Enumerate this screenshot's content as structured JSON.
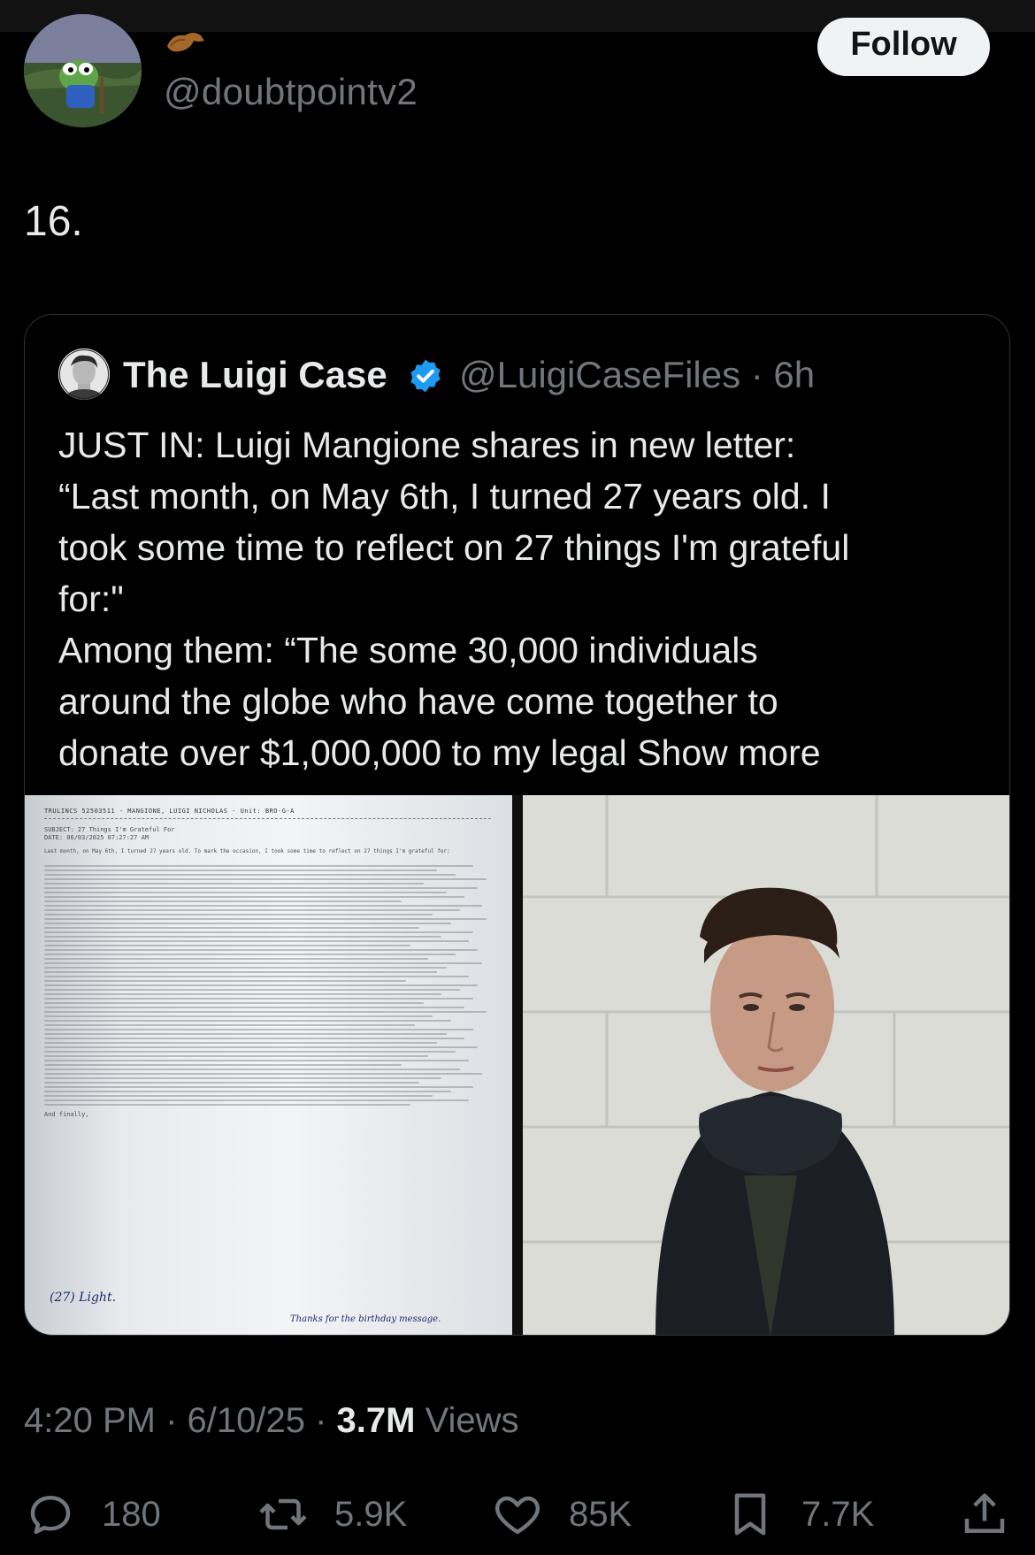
{
  "header": {
    "handle": "@doubtpointv2",
    "follow_label": "Follow",
    "avatar_icon": "frog-avatar-icon",
    "badge_icon": "flexed-arm-emoji-icon"
  },
  "post": {
    "text": "16."
  },
  "quote": {
    "name": "The Luigi Case",
    "handle_time": "@LuigiCaseFiles · 6h",
    "verified_color": "#1d9bf0",
    "lines": [
      "JUST IN: Luigi Mangione shares in new letter:",
      "“Last month, on May 6th, I turned 27 years old. I",
      "took some time to reflect on 27 things I'm grateful",
      "for:\"",
      "Among them: “The some 30,000 individuals",
      "around the globe who have come together to",
      "donate over $1,000,000 to my legal"
    ],
    "show_more": "Show more",
    "media": {
      "letter_header": "TRULINCS 52503511 - MANGIONE, LUIGI NICHOLAS - Unit: BRO-G-A",
      "letter_subject": "SUBJECT: 27 Things I'm Grateful For",
      "letter_date": "DATE: 06/03/2025 07:27:27 AM",
      "letter_intro": "Last month, on May 6th, I turned 27 years old. To mark the occasion, I took some time to reflect on 27 things I'm grateful for:",
      "letter_closing": "And finally,",
      "letter_sign_1": "(27) Light.",
      "letter_sign_2": "Thanks for the birthday message."
    }
  },
  "meta": {
    "time_date": "4:20 PM · 6/10/25 · ",
    "views_count": "3.7M",
    "views_label": " Views"
  },
  "actions": {
    "replies": "180",
    "reposts": "5.9K",
    "likes": "85K",
    "bookmarks": "7.7K"
  },
  "colors": {
    "background": "#000000",
    "text": "#e7e9ea",
    "secondary": "#71767b",
    "border": "#2f3336"
  }
}
